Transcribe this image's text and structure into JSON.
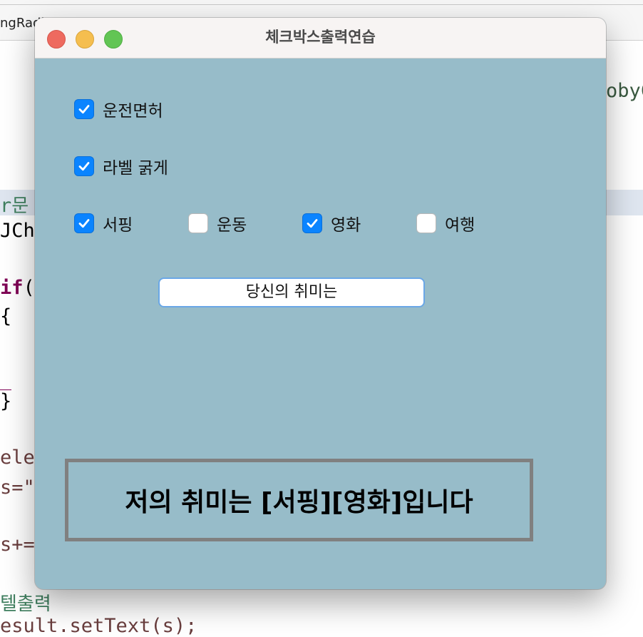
{
  "ide": {
    "tab_label": "ngRadi",
    "snippets": {
      "right_top": "obyC",
      "line_for": "r",
      "line_for_korean": "문",
      "line_jch": "JCh",
      "line_if": "if",
      "line_if_paren": "(",
      "brace_open": "{",
      "brace_close": "}",
      "line_else": "ele",
      "line_s_assign": "s=\"",
      "line_s_plus": "s+=",
      "comment_label_output": "텔출력",
      "bottom_line": "esult.setText(s);"
    }
  },
  "window": {
    "title": "체크박스출력연습"
  },
  "checkboxes": {
    "license": {
      "label": "운전면허",
      "checked": true
    },
    "bold_label": {
      "label": "라벨 굵게",
      "checked": true
    },
    "surfing": {
      "label": "서핑",
      "checked": true
    },
    "exercise": {
      "label": "운동",
      "checked": false
    },
    "movie": {
      "label": "영화",
      "checked": true
    },
    "travel": {
      "label": "여행",
      "checked": false
    }
  },
  "hobby_button": {
    "label": "당신의 취미는"
  },
  "result": {
    "text": "저의 취미는 [서핑][영화]입니다"
  },
  "colors": {
    "window_bg": "#97bcc9",
    "checkbox_on": "#0a84ff",
    "result_border": "#808080"
  }
}
